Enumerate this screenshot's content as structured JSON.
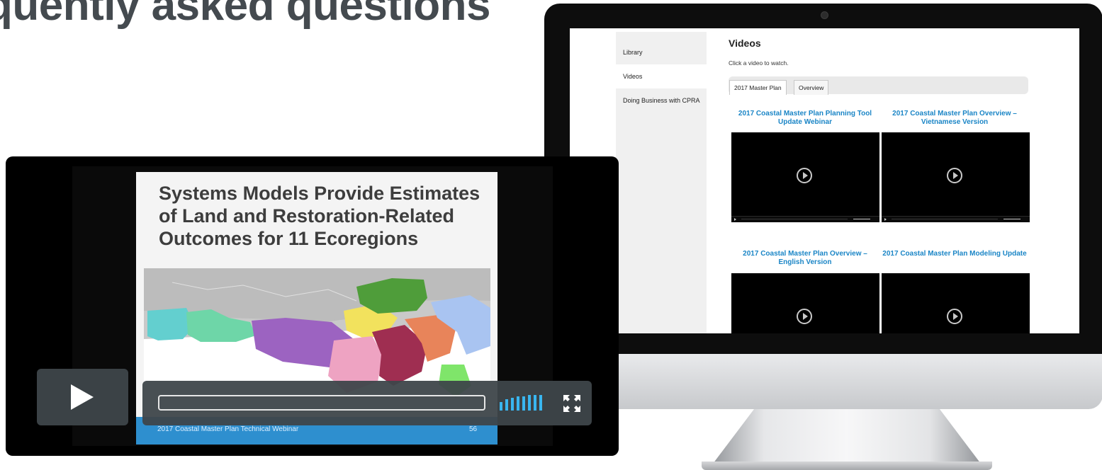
{
  "page": {
    "heading": "quently asked questions"
  },
  "imac": {
    "sidebar": {
      "items": [
        {
          "label": "Library"
        },
        {
          "label": "Videos",
          "active": true
        },
        {
          "label": "Doing Business with CPRA"
        }
      ]
    },
    "main": {
      "title": "Videos",
      "subtitle": "Click a video to watch.",
      "tabs": [
        {
          "label": "2017 Master Plan",
          "active": true
        },
        {
          "label": "Overview"
        }
      ],
      "videos": [
        {
          "title": "2017 Coastal Master Plan Planning Tool Update Webinar"
        },
        {
          "title": "2017 Coastal Master Plan Overview – Vietnamese Version"
        },
        {
          "title": "2017 Coastal Master Plan Overview – English Version"
        },
        {
          "title": "2017 Coastal Master Plan Modeling Update"
        }
      ]
    }
  },
  "player": {
    "slide_title": "Systems Models Provide Estimates of Land and Restoration-Related Outcomes for 11 Ecoregions",
    "footer_text": "2017 Coastal Master Plan Technical Webinar",
    "slide_number": "56",
    "icons": {
      "play": "play-icon",
      "volume": "volume-icon",
      "fullscreen": "fullscreen-icon"
    },
    "colors": {
      "accent": "#39b6f0",
      "footer": "#2e8fcf"
    }
  }
}
